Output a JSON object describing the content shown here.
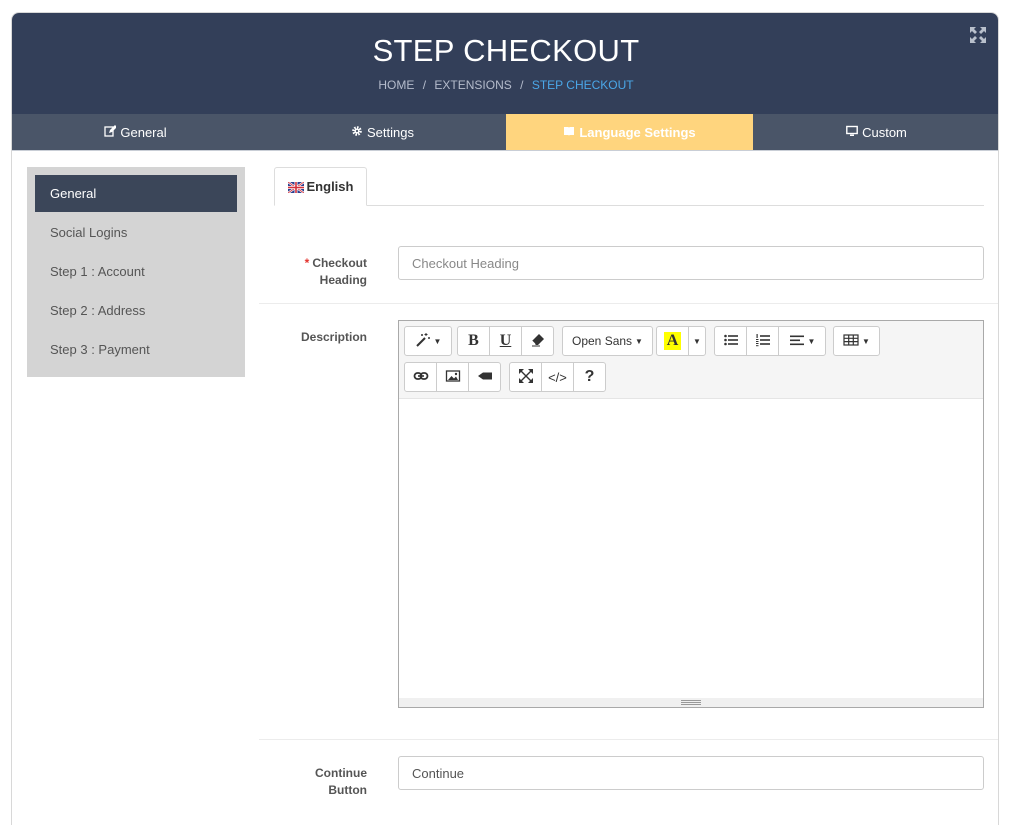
{
  "header": {
    "title": "STEP CHECKOUT",
    "breadcrumb": [
      "HOME",
      "EXTENSIONS",
      "STEP CHECKOUT"
    ],
    "breadcrumb_sep": "/"
  },
  "tabs": [
    {
      "label": "General",
      "icon": "edit-icon"
    },
    {
      "label": "Settings",
      "icon": "gear-icon"
    },
    {
      "label": "Language Settings",
      "icon": "book-icon",
      "active": true
    },
    {
      "label": "Custom",
      "icon": "monitor-icon"
    }
  ],
  "sidebar": {
    "items": [
      {
        "label": "General",
        "active": true
      },
      {
        "label": "Social Logins"
      },
      {
        "label": "Step 1 : Account"
      },
      {
        "label": "Step 2 : Address"
      },
      {
        "label": "Step 3 : Payment"
      }
    ]
  },
  "language_tab": {
    "label": "English",
    "icon": "uk-flag-icon"
  },
  "form": {
    "checkout_heading": {
      "label_line1": "Checkout",
      "label_line2": "Heading",
      "required_mark": "*",
      "value": "",
      "placeholder": "Checkout Heading"
    },
    "description": {
      "label": "Description"
    },
    "continue_button": {
      "label_line1": "Continue",
      "label_line2": "Button",
      "value": "Continue",
      "placeholder": "Continue"
    }
  },
  "editor": {
    "font_name": "Open Sans",
    "color_letter": "A",
    "bold_letter": "B",
    "underline_letter": "U",
    "help_symbol": "?",
    "code_symbol": "</>",
    "highlight_color": "#ffff00"
  },
  "colors": {
    "header_bg": "#333f59",
    "tab_bar_bg": "#4a5568",
    "active_tab_bg": "#ffd57e",
    "sidebar_bg": "#d4d4d4",
    "sidebar_active_bg": "#3b4659",
    "breadcrumb_active": "#4aa7e8"
  }
}
